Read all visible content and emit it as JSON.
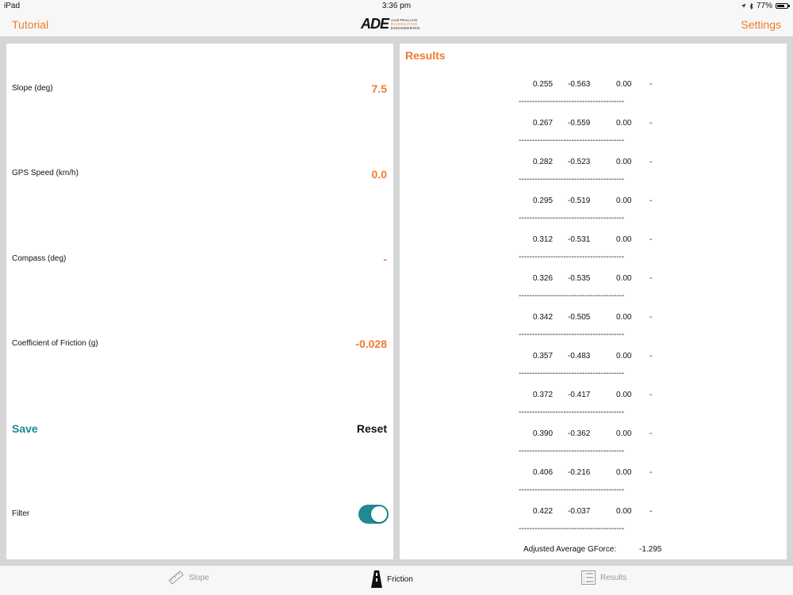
{
  "status": {
    "device": "iPad",
    "time": "3:36 pm",
    "battery": "77%",
    "battery_level": 0.77
  },
  "nav": {
    "left": "Tutorial",
    "right": "Settings",
    "logo_mark": "ADE",
    "logo_lines": [
      "AUSTRALIAN",
      "DIVERSIFIED",
      "ENGINEERING"
    ]
  },
  "left": {
    "rows": [
      {
        "label": "Slope (deg)",
        "value": "7.5"
      },
      {
        "label": "GPS Speed (km/h)",
        "value": "0.0"
      },
      {
        "label": "Compass (deg)",
        "value": "-"
      },
      {
        "label": "Coefficient of Friction (g)",
        "value": "-0.028"
      }
    ],
    "save": "Save",
    "reset": "Reset",
    "filter_label": "Filter",
    "filter_on": true
  },
  "results": {
    "title": "Results",
    "separator": "----------------------------------------",
    "rows": [
      [
        "0.255",
        "-0.563",
        "0.00",
        "-"
      ],
      [
        "0.267",
        "-0.559",
        "0.00",
        "-"
      ],
      [
        "0.282",
        "-0.523",
        "0.00",
        "-"
      ],
      [
        "0.295",
        "-0.519",
        "0.00",
        "-"
      ],
      [
        "0.312",
        "-0.531",
        "0.00",
        "-"
      ],
      [
        "0.326",
        "-0.535",
        "0.00",
        "-"
      ],
      [
        "0.342",
        "-0.505",
        "0.00",
        "-"
      ],
      [
        "0.357",
        "-0.483",
        "0.00",
        "-"
      ],
      [
        "0.372",
        "-0.417",
        "0.00",
        "-"
      ],
      [
        "0.390",
        "-0.362",
        "0.00",
        "-"
      ],
      [
        "0.406",
        "-0.216",
        "0.00",
        "-"
      ],
      [
        "0.422",
        "-0.037",
        "0.00",
        "-"
      ]
    ],
    "summary_label": "Adjusted Average GForce:",
    "summary_value": "-1.295"
  },
  "tabs": [
    {
      "label": "Slope",
      "icon": "ruler-icon",
      "active": false
    },
    {
      "label": "Friction",
      "icon": "road-icon",
      "active": true
    },
    {
      "label": "Results",
      "icon": "list-icon",
      "active": false
    }
  ],
  "colors": {
    "accent": "#f07b2d",
    "teal": "#1f8a8f"
  }
}
